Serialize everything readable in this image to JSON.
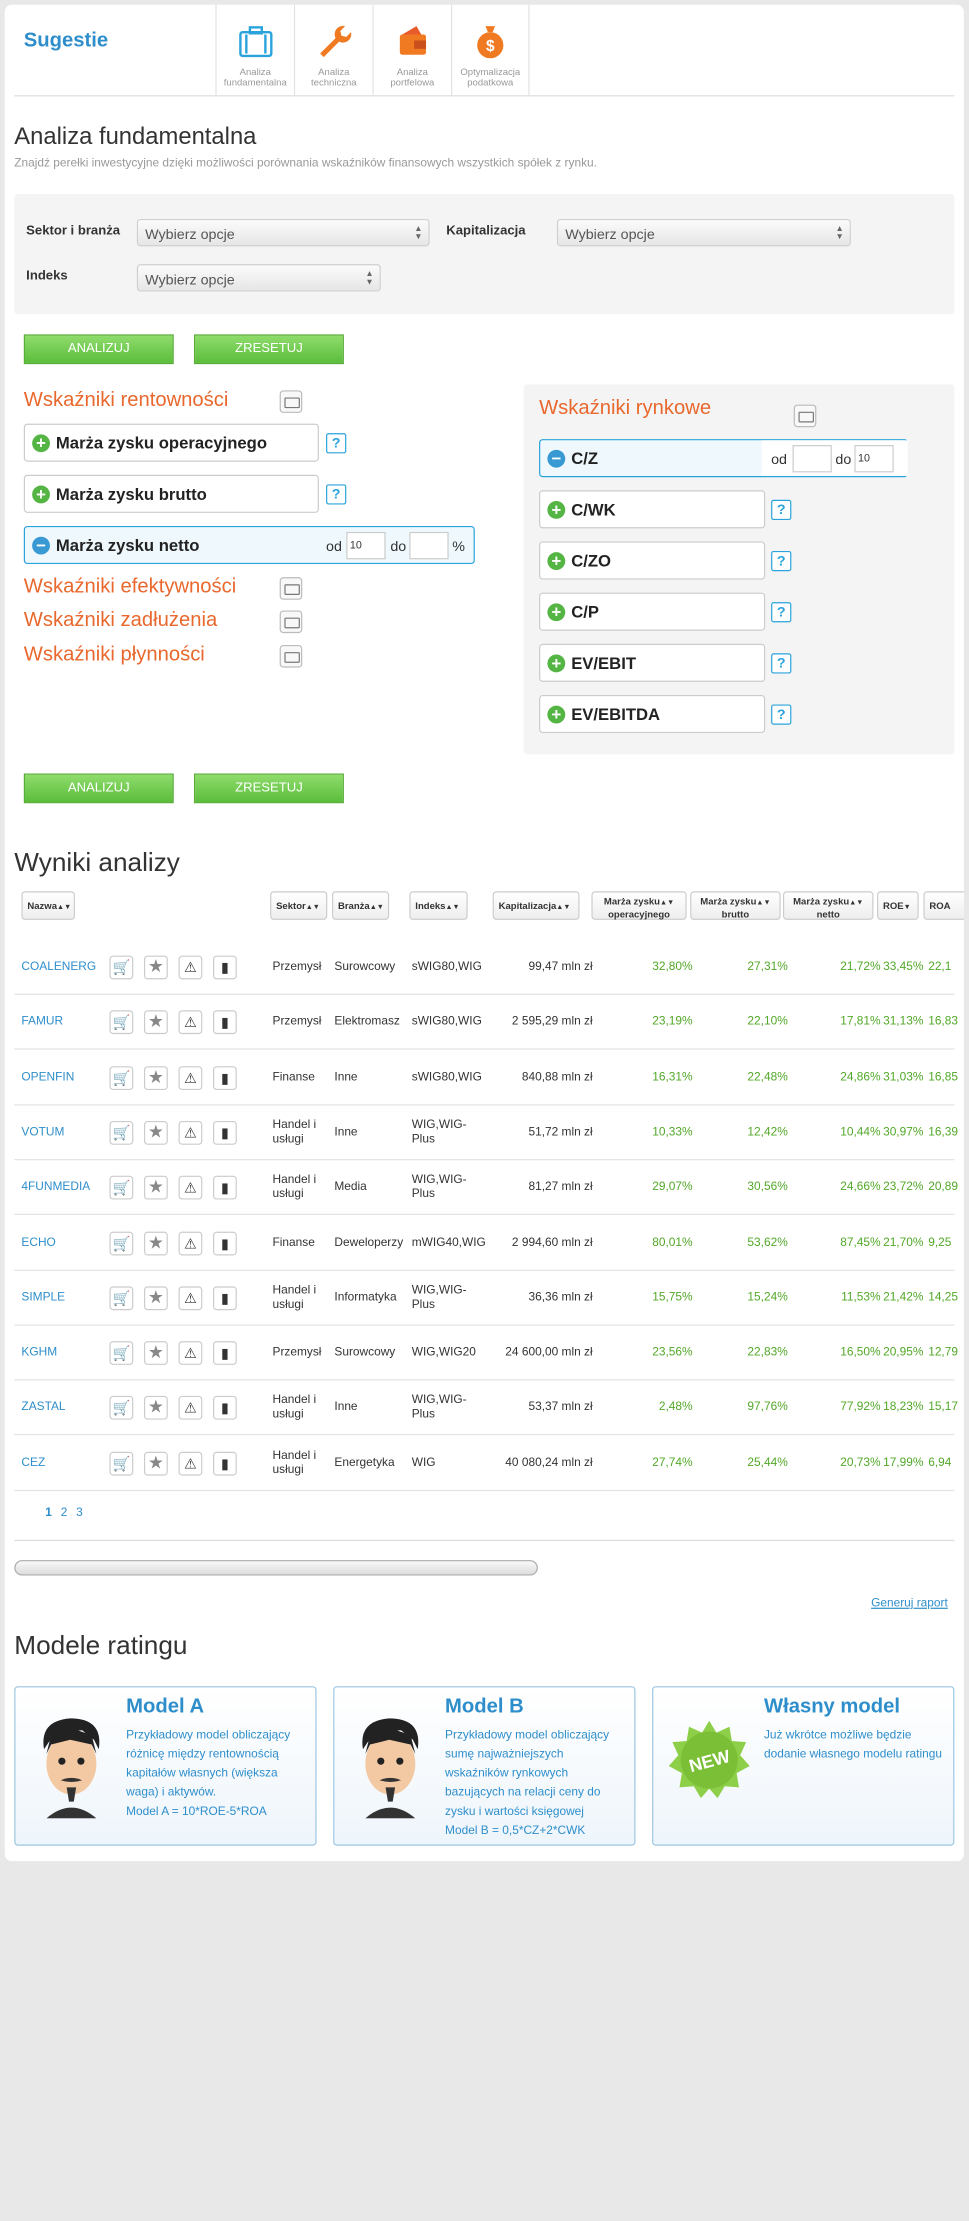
{
  "header": {
    "brand": "Sugestie",
    "tabs": [
      {
        "label1": "Analiza",
        "label2": "fundamentalna",
        "icon": "briefcase-icon"
      },
      {
        "label1": "Analiza",
        "label2": "techniczna",
        "icon": "wrench-icon"
      },
      {
        "label1": "Analiza",
        "label2": "portfelowa",
        "icon": "wallet-icon"
      },
      {
        "label1": "Optymalizacja",
        "label2": "podatkowa",
        "icon": "money-bag-icon"
      }
    ]
  },
  "analysis": {
    "title": "Analiza fundamentalna",
    "subtitle": "Znajdź perełki inwestycyjne dzięki możliwości porównania wskaźników finansowych wszystkich spółek z rynku."
  },
  "filters": {
    "sector_label": "Sektor i branża",
    "sector_value": "Wybierz opcje",
    "cap_label": "Kapitalizacja",
    "cap_value": "Wybierz opcje",
    "index_label": "Indeks",
    "index_value": "Wybierz opcje"
  },
  "buttons": {
    "analyze": "ANALIZUJ",
    "reset": "ZRESETUJ"
  },
  "profitability": {
    "title": "Wskaźniki rentowności",
    "items": [
      "Marża zysku operacyjnego",
      "Marża zysku brutto",
      "Marża zysku netto"
    ],
    "net": {
      "from_label": "od",
      "from_value": "10",
      "to_label": "do",
      "to_value": "",
      "unit": "%"
    }
  },
  "groups": [
    "Wskaźniki efektywności",
    "Wskaźniki zadłużenia",
    "Wskaźniki płynności"
  ],
  "market": {
    "title": "Wskaźniki rynkowe",
    "items": [
      "C/Z",
      "C/WK",
      "C/ZO",
      "C/P",
      "EV/EBIT",
      "EV/EBITDA"
    ],
    "cz": {
      "from_label": "od",
      "from_value": "",
      "to_label": "do",
      "to_value": "10"
    }
  },
  "help": "?",
  "results": {
    "title": "Wyniki analizy",
    "headers": {
      "name": "Nazwa",
      "sector": "Sektor",
      "industry": "Branża",
      "index": "Indeks",
      "cap": "Kapitalizacja",
      "op1": "Marża zysku",
      "op2": "operacyjnego",
      "br1": "Marża zysku",
      "br2": "brutto",
      "nt1": "Marża zysku",
      "nt2": "netto",
      "roe": "ROE",
      "roa": "ROA"
    },
    "rows": [
      {
        "name": "COALENERG",
        "sector": "Przemysł",
        "industry": "Surowcowy",
        "index": "sWIG80,WIG",
        "cap": "99,47 mln zł",
        "op": "32,80%",
        "br": "27,31%",
        "nt": "21,72%",
        "roe": "33,45%",
        "roa": "22,1"
      },
      {
        "name": "FAMUR",
        "sector": "Przemysł",
        "industry": "Elektromasz",
        "index": "sWIG80,WIG",
        "cap": "2 595,29 mln zł",
        "op": "23,19%",
        "br": "22,10%",
        "nt": "17,81%",
        "roe": "31,13%",
        "roa": "16,83"
      },
      {
        "name": "OPENFIN",
        "sector": "Finanse",
        "industry": "Inne",
        "index": "sWIG80,WIG",
        "cap": "840,88 mln zł",
        "op": "16,31%",
        "br": "22,48%",
        "nt": "24,86%",
        "roe": "31,03%",
        "roa": "16,85"
      },
      {
        "name": "VOTUM",
        "sector": "Handel i usługi",
        "industry": "Inne",
        "index": "WIG,WIG-Plus",
        "cap": "51,72 mln zł",
        "op": "10,33%",
        "br": "12,42%",
        "nt": "10,44%",
        "roe": "30,97%",
        "roa": "16,39"
      },
      {
        "name": "4FUNMEDIA",
        "sector": "Handel i usługi",
        "industry": "Media",
        "index": "WIG,WIG-Plus",
        "cap": "81,27 mln zł",
        "op": "29,07%",
        "br": "30,56%",
        "nt": "24,66%",
        "roe": "23,72%",
        "roa": "20,89"
      },
      {
        "name": "ECHO",
        "sector": "Finanse",
        "industry": "Deweloperzy",
        "index": "mWIG40,WIG",
        "cap": "2 994,60 mln zł",
        "op": "80,01%",
        "br": "53,62%",
        "nt": "87,45%",
        "roe": "21,70%",
        "roa": "9,25"
      },
      {
        "name": "SIMPLE",
        "sector": "Handel i usługi",
        "industry": "Informatyka",
        "index": "WIG,WIG-Plus",
        "cap": "36,36 mln zł",
        "op": "15,75%",
        "br": "15,24%",
        "nt": "11,53%",
        "roe": "21,42%",
        "roa": "14,25"
      },
      {
        "name": "KGHM",
        "sector": "Przemysł",
        "industry": "Surowcowy",
        "index": "WIG,WIG20",
        "cap": "24 600,00 mln zł",
        "op": "23,56%",
        "br": "22,83%",
        "nt": "16,50%",
        "roe": "20,95%",
        "roa": "12,79"
      },
      {
        "name": "ZASTAL",
        "sector": "Handel i usługi",
        "industry": "Inne",
        "index": "WIG,WIG-Plus",
        "cap": "53,37 mln zł",
        "op": "2,48%",
        "br": "97,76%",
        "nt": "77,92%",
        "roe": "18,23%",
        "roa": "15,17"
      },
      {
        "name": "CEZ",
        "sector": "Handel i usługi",
        "industry": "Energetyka",
        "index": "WIG",
        "cap": "40 080,24 mln zł",
        "op": "27,74%",
        "br": "25,44%",
        "nt": "20,73%",
        "roe": "17,99%",
        "roa": "6,94"
      }
    ],
    "pages": [
      "1",
      "2",
      "3"
    ],
    "report": "Generuj raport"
  },
  "rating": {
    "title": "Modele ratingu",
    "cards": [
      {
        "title": "Model A",
        "text": "Przykładowy model obliczający różnicę między rentownością kapitałów własnych (większa waga) i aktywów.",
        "formula": "Model A = 10*ROE-5*ROA"
      },
      {
        "title": "Model B",
        "text": "Przykładowy model obliczający sumę najważniejszych wskaźników rynkowych bazujących na relacji ceny do zysku i wartości księgowej",
        "formula": "Model B = 0,5*CZ+2*CWK"
      },
      {
        "title": "Własny model",
        "text": "Już wkrótce możliwe będzie dodanie własnego modelu ratingu",
        "badge": "NEW"
      }
    ]
  },
  "colors": {
    "accent": "#2e8ecb",
    "orange": "#e8682d",
    "green": "#5bbd3b"
  }
}
